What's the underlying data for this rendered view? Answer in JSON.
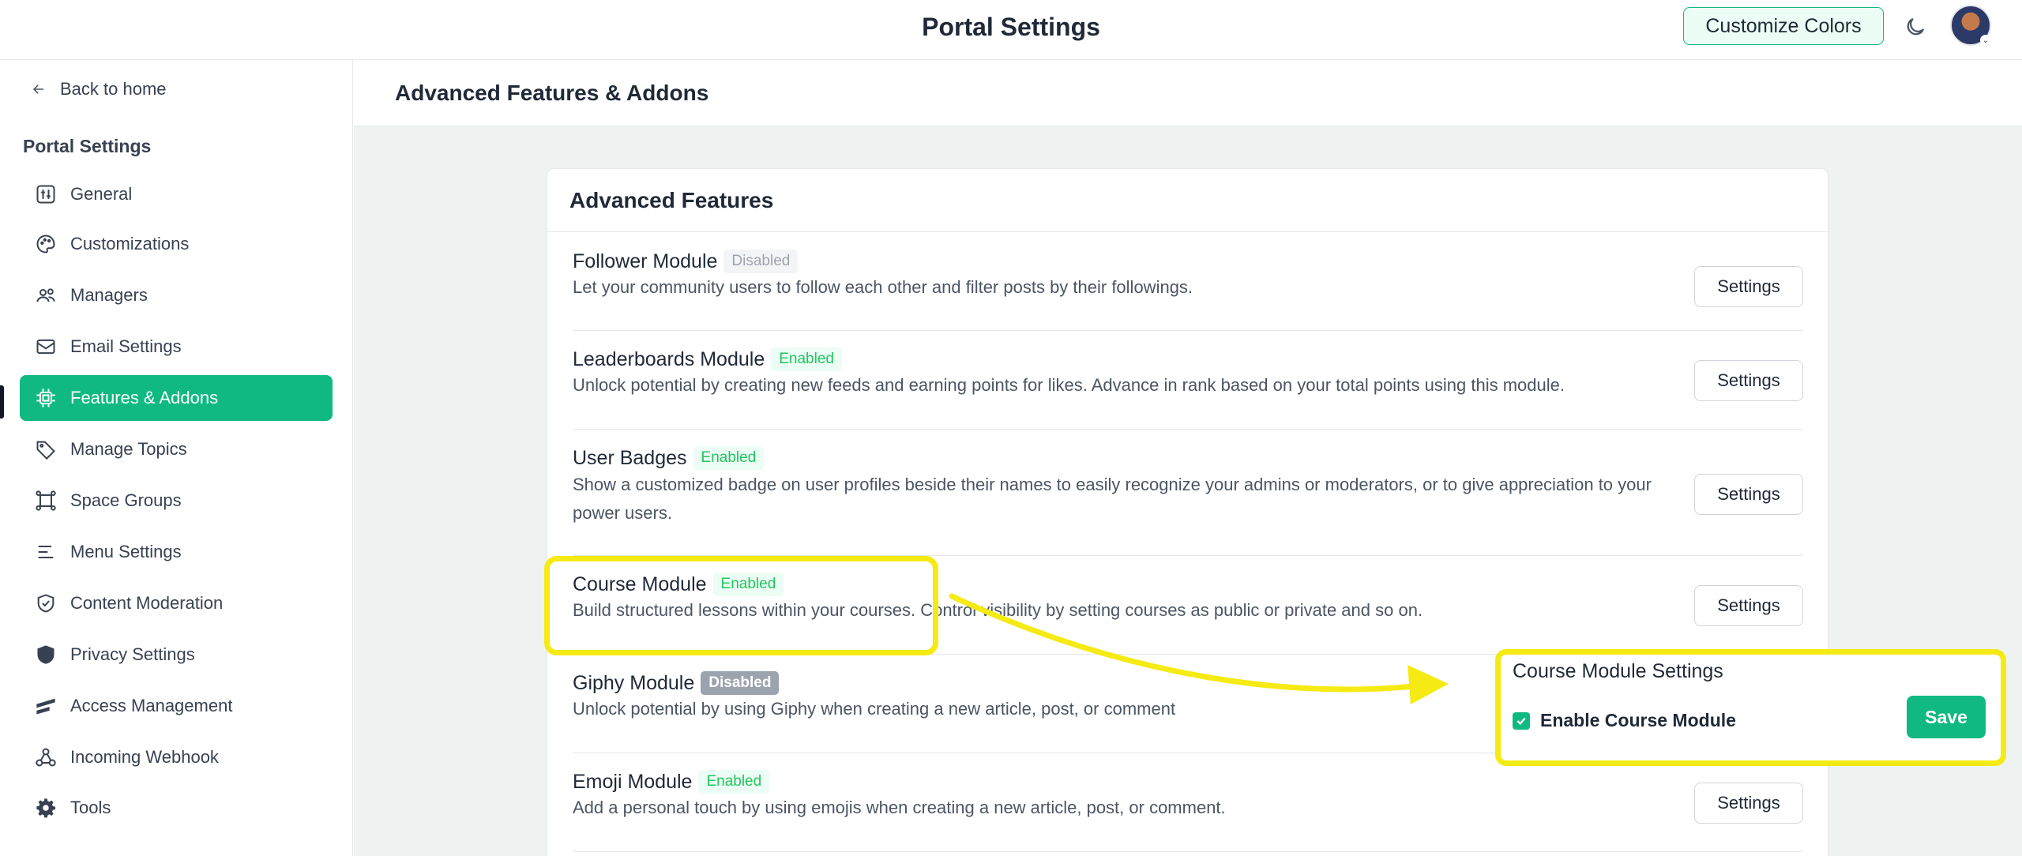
{
  "header": {
    "title": "Portal Settings",
    "customize_label": "Customize Colors"
  },
  "sidebar": {
    "back_label": "Back to home",
    "heading": "Portal Settings",
    "items": [
      {
        "label": "General",
        "icon": "general-icon"
      },
      {
        "label": "Customizations",
        "icon": "palette-icon"
      },
      {
        "label": "Managers",
        "icon": "users-icon"
      },
      {
        "label": "Email Settings",
        "icon": "mail-icon"
      },
      {
        "label": "Features & Addons",
        "icon": "chip-icon",
        "active": true
      },
      {
        "label": "Manage Topics",
        "icon": "tag-icon"
      },
      {
        "label": "Space Groups",
        "icon": "group-icon"
      },
      {
        "label": "Menu Settings",
        "icon": "menu-icon"
      },
      {
        "label": "Content Moderation",
        "icon": "shield-check-icon"
      },
      {
        "label": "Privacy Settings",
        "icon": "shield-icon"
      },
      {
        "label": "Access Management",
        "icon": "access-icon"
      },
      {
        "label": "Incoming Webhook",
        "icon": "webhook-icon"
      },
      {
        "label": "Tools",
        "icon": "gear-icon"
      }
    ]
  },
  "main": {
    "page_title": "Advanced Features & Addons",
    "card_title": "Advanced Features",
    "settings_label": "Settings",
    "modules": [
      {
        "name": "Follower Module",
        "status": "Disabled",
        "description": "Let your community users to follow each other and filter posts by their followings."
      },
      {
        "name": "Leaderboards Module",
        "status": "Enabled",
        "description": "Unlock potential by creating new feeds and earning points for likes. Advance in rank based on your total points using this module."
      },
      {
        "name": "User Badges",
        "status": "Enabled",
        "description": "Show a customized badge on user profiles beside their names to easily recognize your admins or moderators, or to give appreciation to your power users."
      },
      {
        "name": "Course Module",
        "status": "Enabled",
        "description": "Build structured lessons within your courses. Control visibility by setting courses as public or private and so on."
      },
      {
        "name": "Giphy Module",
        "status": "Disabled",
        "description": "Unlock potential by using Giphy when creating a new article, post, or comment"
      },
      {
        "name": "Emoji Module",
        "status": "Enabled",
        "description": "Add a personal touch by using emojis when creating a new article, post, or comment."
      }
    ]
  },
  "course_panel": {
    "title": "Course Module Settings",
    "checkbox_label": "Enable Course Module",
    "checked": true,
    "save_label": "Save"
  },
  "colors": {
    "accent": "#10b981",
    "highlight": "#f5ea14"
  }
}
